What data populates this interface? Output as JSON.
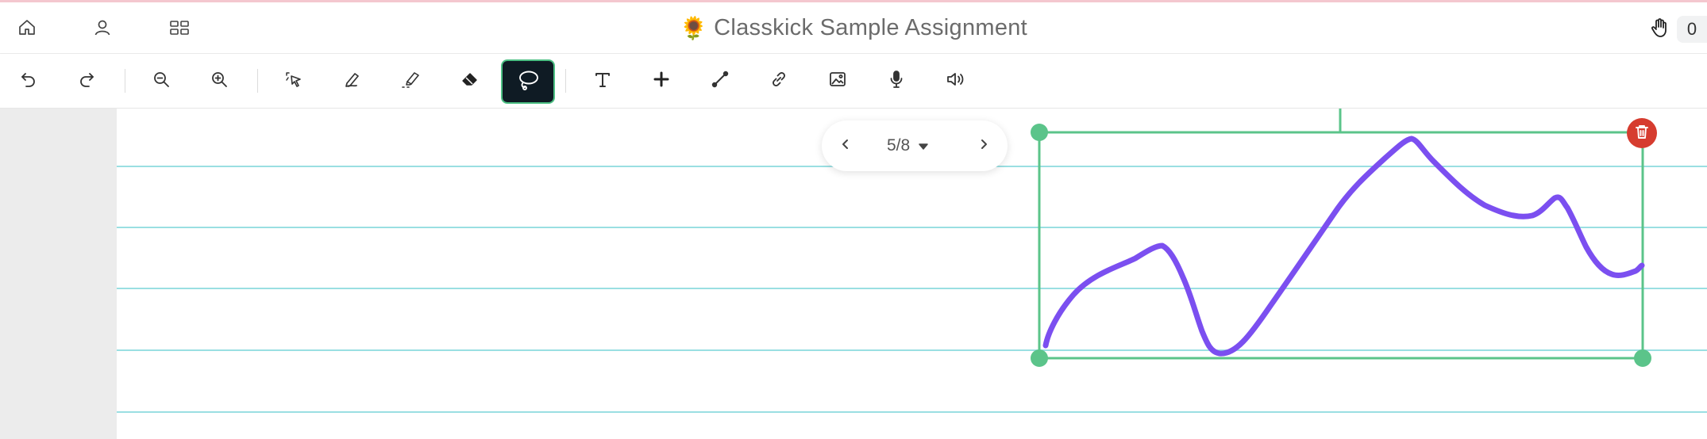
{
  "header": {
    "title_emoji": "🌻",
    "title": "Classkick Sample Assignment",
    "hand_count": "0",
    "icons": {
      "home": "home-icon",
      "user": "user-icon",
      "grid": "grid-icon",
      "hand": "raise-hand-icon"
    }
  },
  "toolbar": {
    "tools": [
      "undo",
      "redo",
      "zoom-out",
      "zoom-in",
      "select",
      "pen",
      "highlighter",
      "eraser",
      "lasso",
      "text",
      "sticker-plus",
      "line",
      "link",
      "image",
      "microphone",
      "audio"
    ],
    "active_tool": "lasso"
  },
  "pager": {
    "label": "5/8"
  },
  "selection": {
    "stroke_color": "#7b4ff0",
    "frame_color": "#5bc48a",
    "delete_color": "#d63c2f"
  },
  "colors": {
    "ruled_line": "#9adfe2",
    "active_tool_bg": "#0f1b24",
    "gutter": "#ececec"
  }
}
